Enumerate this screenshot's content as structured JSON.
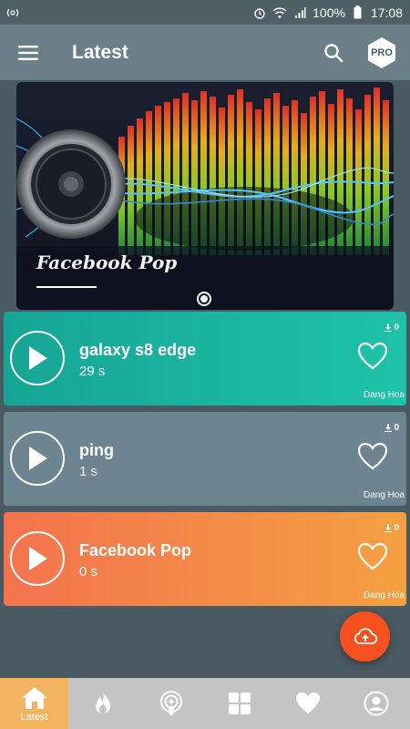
{
  "status_bar": {
    "battery": "100%",
    "time": "17:08"
  },
  "app_bar": {
    "title": "Latest",
    "pro_badge": "PRO"
  },
  "banner": {
    "title": "Facebook Pop"
  },
  "sounds": [
    {
      "name": "galaxy s8 edge",
      "duration": "29 s",
      "downloads": "0",
      "author": "Dang Hoa",
      "color": "#1aae9c"
    },
    {
      "name": "ping",
      "duration": "1 s",
      "downloads": "0",
      "author": "Dang Hoa",
      "color": "#6c8591"
    },
    {
      "name": "Facebook Pop",
      "duration": "0 s",
      "downloads": "0",
      "author": "Dang Hoa",
      "color": "#f48a48"
    }
  ],
  "bottom_nav": {
    "items": [
      {
        "label": "Latest",
        "icon": "home-icon",
        "active": true
      },
      {
        "label": "",
        "icon": "fire-icon",
        "active": false
      },
      {
        "label": "",
        "icon": "podcast-icon",
        "active": false
      },
      {
        "label": "",
        "icon": "grid-icon",
        "active": false
      },
      {
        "label": "",
        "icon": "heart-icon",
        "active": false
      },
      {
        "label": "",
        "icon": "account-icon",
        "active": false
      }
    ]
  },
  "colors": {
    "app_bar": "#6a7f88",
    "background": "#4a5a62",
    "fab": "#f4511e",
    "nav_active": "#f4b45f"
  }
}
